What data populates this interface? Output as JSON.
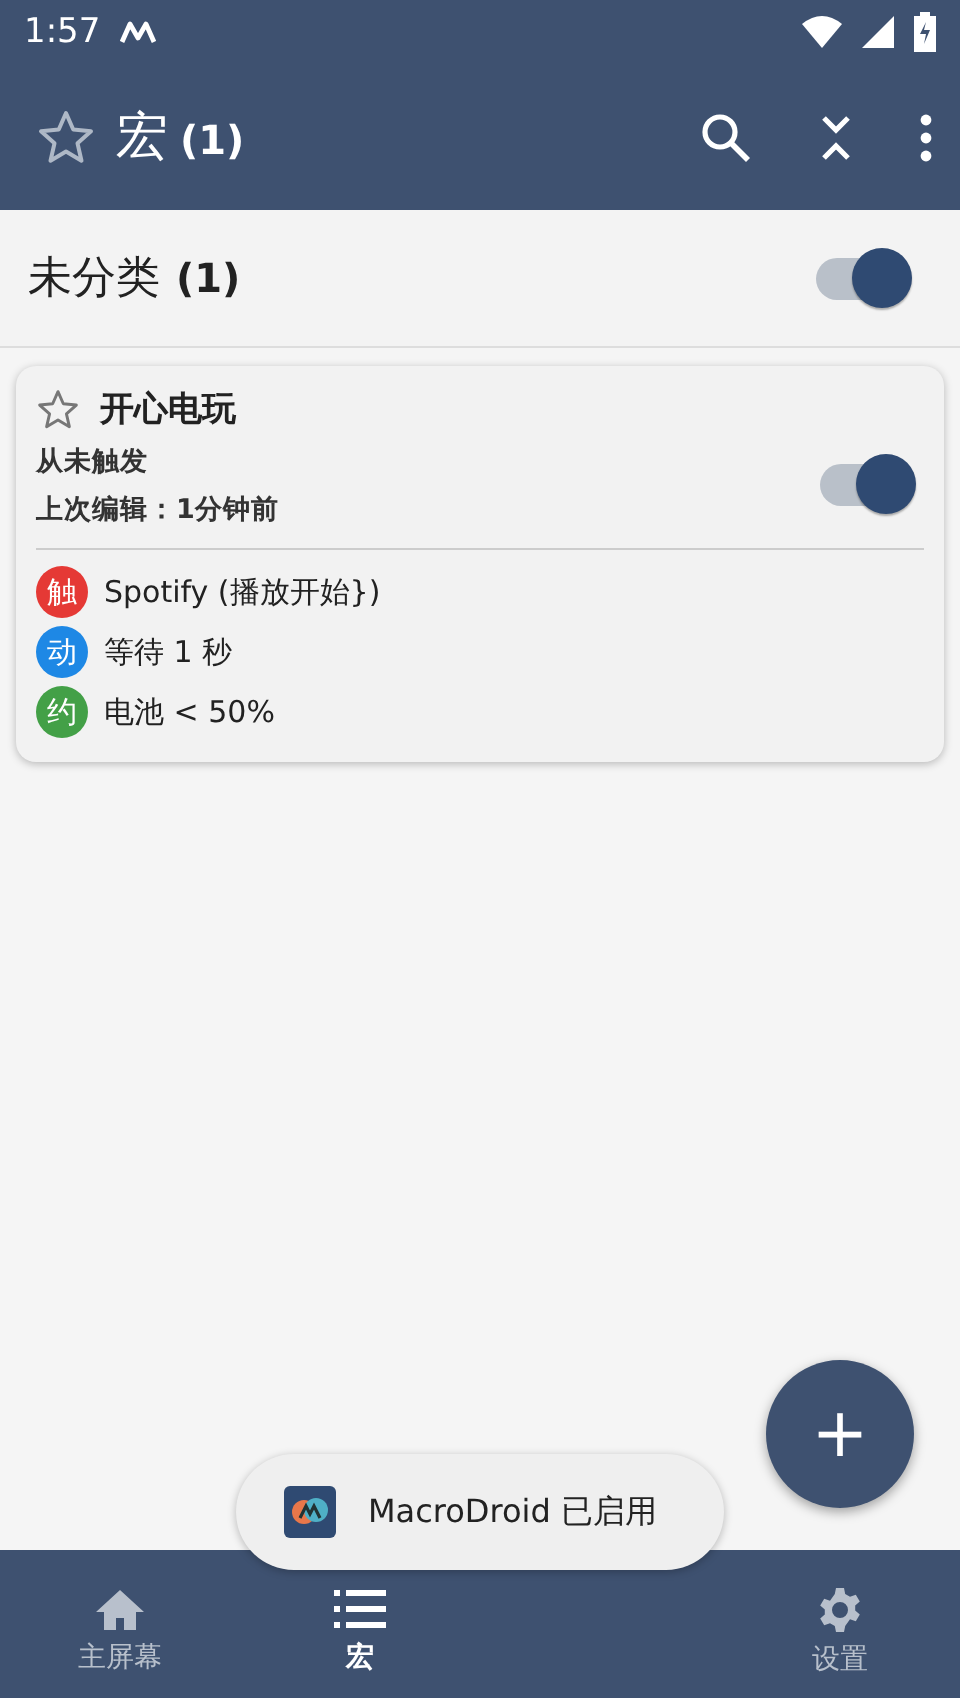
{
  "status_bar": {
    "time": "1:57"
  },
  "app_bar": {
    "title": "宏",
    "count": "(1)"
  },
  "category": {
    "name": "未分类",
    "count": "(1)",
    "on": true
  },
  "macros": [
    {
      "name": "开心电玩",
      "on": true,
      "starred": false,
      "trigger_status": "从未触发",
      "edited": "上次编辑：1分钟前",
      "steps": [
        {
          "badge": "触",
          "text": "Spotify (播放开始})",
          "color": "#e53935"
        },
        {
          "badge": "动",
          "text": "等待 1 秒",
          "color": "#1e88e5"
        },
        {
          "badge": "约",
          "text": "电池 < 50%",
          "color": "#43a047"
        }
      ]
    }
  ],
  "toast": {
    "text": "MacroDroid 已启用"
  },
  "fab": {
    "label": "+"
  },
  "bottom_nav": [
    {
      "label": "主屏幕",
      "kind": "home",
      "selected": false
    },
    {
      "label": "宏",
      "kind": "list",
      "selected": true
    },
    {
      "label": "设置",
      "kind": "gear",
      "selected": false
    }
  ]
}
